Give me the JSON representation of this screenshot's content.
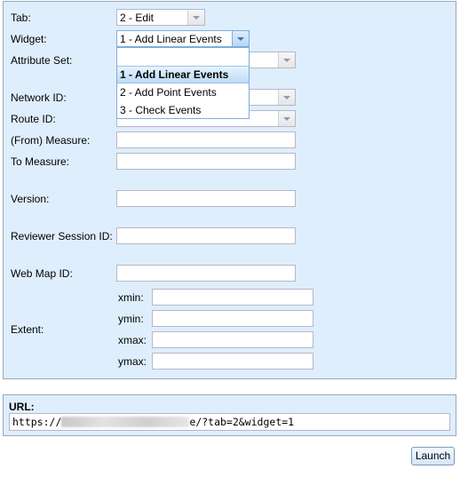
{
  "form": {
    "tab": {
      "label": "Tab:",
      "value": "2 - Edit"
    },
    "widget": {
      "label": "Widget:",
      "value": "1 - Add Linear Events",
      "options": [
        "",
        "1 - Add Linear Events",
        "2 - Add Point Events",
        "3 - Check Events"
      ],
      "selected_index": 1
    },
    "attribute_set": {
      "label": "Attribute Set:",
      "value": ""
    },
    "network_id": {
      "label": "Network ID:",
      "value": ""
    },
    "route_id": {
      "label": "Route ID:",
      "value": ""
    },
    "from_measure": {
      "label": "(From) Measure:",
      "value": ""
    },
    "to_measure": {
      "label": "To Measure:",
      "value": ""
    },
    "version": {
      "label": "Version:",
      "value": ""
    },
    "reviewer_session_id": {
      "label": "Reviewer Session ID:",
      "value": ""
    },
    "web_map_id": {
      "label": "Web Map ID:",
      "value": ""
    },
    "extent": {
      "label": "Extent:",
      "xmin": {
        "label": "xmin:",
        "value": ""
      },
      "ymin": {
        "label": "ymin:",
        "value": ""
      },
      "xmax": {
        "label": "xmax:",
        "value": ""
      },
      "ymax": {
        "label": "ymax:",
        "value": ""
      }
    }
  },
  "url": {
    "label": "URL:",
    "prefix": "https://",
    "suffix": "e/?tab=2&widget=1"
  },
  "launch_label": "Launch"
}
